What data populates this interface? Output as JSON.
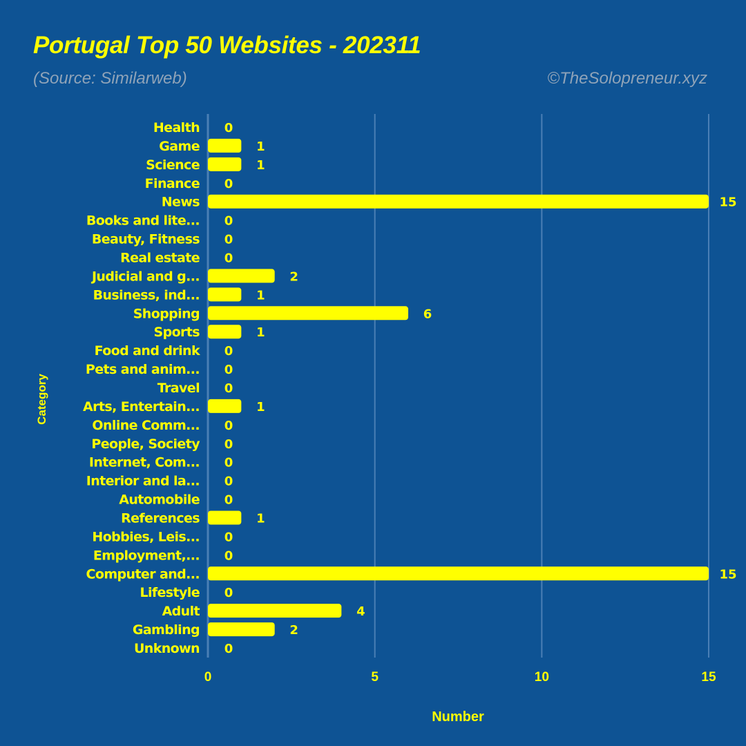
{
  "header": {
    "title": "Portugal Top 50 Websites - 202311",
    "subtitle": "(Source: Similarweb)",
    "credit": "©TheSolopreneur.xyz"
  },
  "colors": {
    "background": "#0e5394",
    "bar": "#ffff00",
    "text": "#ffff00",
    "muted": "#8fa3b8",
    "grid": "#4a7fb5"
  },
  "chart_data": {
    "type": "bar",
    "orientation": "horizontal",
    "title": "Portugal Top 50 Websites - 202311",
    "subtitle": "(Source: Similarweb)",
    "xlabel": "Number",
    "ylabel": "Category",
    "xlim": [
      0,
      15
    ],
    "xticks": [
      0,
      5,
      10,
      15
    ],
    "grid": true,
    "categories": [
      "Health",
      "Game",
      "Science",
      "Finance",
      "News",
      "Books and lite...",
      "Beauty, Fitness",
      "Real estate",
      "Judicial and g...",
      "Business, ind...",
      "Shopping",
      "Sports",
      "Food and drink",
      "Pets and anim...",
      "Travel",
      "Arts, Entertain...",
      "Online Comm...",
      "People, Society",
      "Internet, Com...",
      "Interior and la...",
      "Automobile",
      "References",
      "Hobbies, Leis...",
      "Employment,...",
      "Computer and...",
      "Lifestyle",
      "Adult",
      "Gambling",
      "Unknown"
    ],
    "values": [
      0,
      1,
      1,
      0,
      15,
      0,
      0,
      0,
      2,
      1,
      6,
      1,
      0,
      0,
      0,
      1,
      0,
      0,
      0,
      0,
      0,
      1,
      0,
      0,
      15,
      0,
      4,
      2,
      0
    ]
  }
}
